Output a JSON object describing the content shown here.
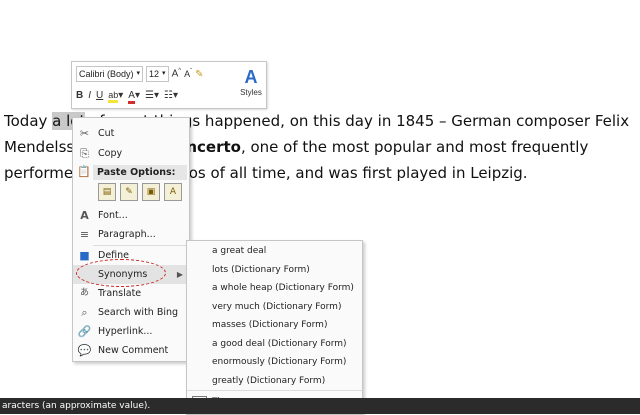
{
  "document": {
    "lines": [
      {
        "before": "Today ",
        "selected": "a lot",
        "after": " of great things happened, on this day in 1845 – German composer Felix"
      },
      {
        "before": "Mendelssohn's Violin ",
        "bold": "Concerto",
        "after": ", one of the most popular and most frequently"
      },
      {
        "before": "performed violin concertos of all time, and was first played in Leipzig.",
        "bold": "",
        "after": ""
      }
    ]
  },
  "mini_toolbar": {
    "font_name": "Calibri (Body)",
    "font_size": "12",
    "grow_font": "A",
    "shrink_font": "A",
    "bold": "B",
    "italic": "I",
    "underline": "U",
    "font_color": "A",
    "styles_label": "Styles",
    "styles_glyph": "A"
  },
  "context_menu": {
    "cut": "Cut",
    "copy": "Copy",
    "paste_options": "Paste Options:",
    "font": "Font...",
    "paragraph": "Paragraph...",
    "define": "Define",
    "synonyms": "Synonyms",
    "translate": "Translate",
    "search_bing": "Search with Bing",
    "hyperlink": "Hyperlink...",
    "new_comment": "New Comment"
  },
  "synonyms_submenu": {
    "items": [
      "a great deal",
      "lots (Dictionary Form)",
      "a whole heap (Dictionary Form)",
      "very much (Dictionary Form)",
      "masses (Dictionary Form)",
      "a good deal (Dictionary Form)",
      "enormously (Dictionary Form)",
      "greatly (Dictionary Form)"
    ],
    "thesaurus": "Thesaurus..."
  },
  "status_bar": {
    "text": "aracters (an approximate value)."
  },
  "colors": {
    "selection": "#c9c9c9",
    "highlight_oval": "#cc2222",
    "status_bar": "#2b2b2b"
  }
}
